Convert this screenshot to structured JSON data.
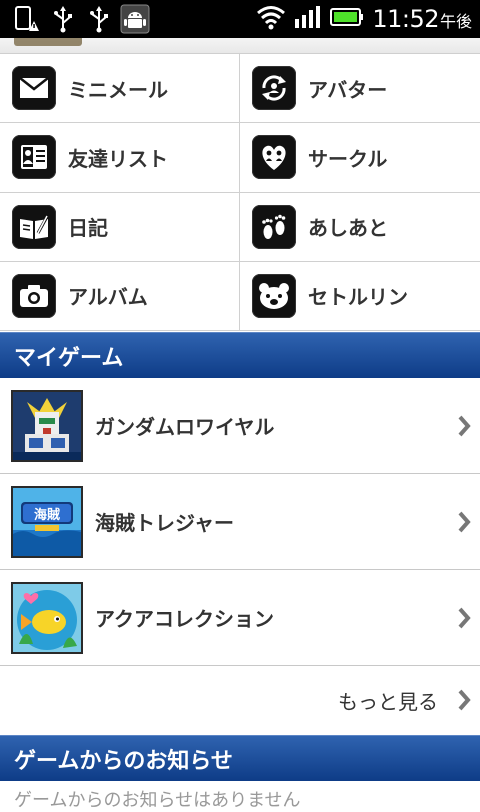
{
  "status_bar": {
    "time": "11:52",
    "ampm": "午後",
    "left_icons": [
      "alert-icon",
      "usb-icon",
      "usb-icon",
      "android-debug-icon"
    ],
    "right_icons": [
      "wifi-icon",
      "signal-icon",
      "battery-icon"
    ]
  },
  "menu": {
    "items": [
      {
        "label": "ミニメール",
        "icon": "mail-icon"
      },
      {
        "label": "アバター",
        "icon": "avatar-icon"
      },
      {
        "label": "友達リスト",
        "icon": "friends-list-icon"
      },
      {
        "label": "サークル",
        "icon": "circle-heart-icon"
      },
      {
        "label": "日記",
        "icon": "diary-icon"
      },
      {
        "label": "あしあと",
        "icon": "footprints-icon"
      },
      {
        "label": "アルバム",
        "icon": "camera-icon"
      },
      {
        "label": "セトルリン",
        "icon": "bear-icon"
      }
    ]
  },
  "my_game": {
    "title": "マイゲーム",
    "games": [
      {
        "name": "ガンダムロワイヤル",
        "icon": "gundam-thumbnail"
      },
      {
        "name": "海賊トレジャー",
        "icon": "pirate-treasure-thumbnail"
      },
      {
        "name": "アクアコレクション",
        "icon": "aqua-collection-thumbnail"
      }
    ],
    "more_label": "もっと見る"
  },
  "news": {
    "title": "ゲームからのお知らせ",
    "partial_text": "ゲームからのお知らせはありません"
  },
  "colors": {
    "section_header": "#1b4c9c",
    "icon_bg": "#111111",
    "battery_green": "#4ee02a"
  }
}
